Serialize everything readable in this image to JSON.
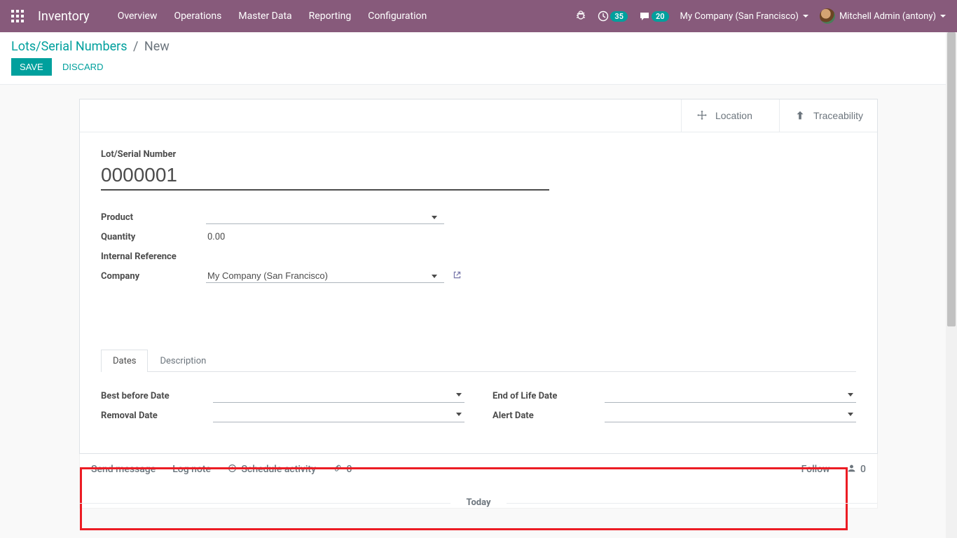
{
  "navbar": {
    "brand": "Inventory",
    "menu": [
      "Overview",
      "Operations",
      "Master Data",
      "Reporting",
      "Configuration"
    ],
    "badge1": "35",
    "badge2": "20",
    "company": "My Company (San Francisco)",
    "user": "Mitchell Admin (antony)"
  },
  "breadcrumb": {
    "root": "Lots/Serial Numbers",
    "current": "New"
  },
  "actions": {
    "save": "SAVE",
    "discard": "DISCARD"
  },
  "stat_buttons": {
    "location": "Location",
    "traceability": "Traceability"
  },
  "form": {
    "title_label": "Lot/Serial Number",
    "title_value": "0000001",
    "product_label": "Product",
    "product_value": "",
    "quantity_label": "Quantity",
    "quantity_value": "0.00",
    "internal_ref_label": "Internal Reference",
    "internal_ref_value": "",
    "company_label": "Company",
    "company_value": "My Company (San Francisco)"
  },
  "tabs": {
    "dates": "Dates",
    "description": "Description"
  },
  "dates": {
    "best_before_label": "Best before Date",
    "best_before_value": "",
    "removal_label": "Removal Date",
    "removal_value": "",
    "eol_label": "End of Life Date",
    "eol_value": "",
    "alert_label": "Alert Date",
    "alert_value": ""
  },
  "chatter": {
    "send": "Send message",
    "log": "Log note",
    "schedule": "Schedule activity",
    "attach_count": "0",
    "follow": "Follow",
    "follower_count": "0",
    "today": "Today"
  }
}
